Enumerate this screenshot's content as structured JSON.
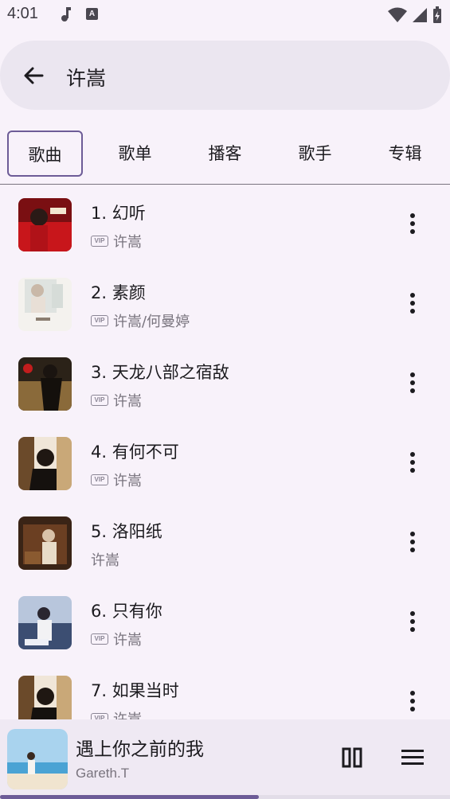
{
  "status": {
    "time": "4:01"
  },
  "search": {
    "query": "许嵩"
  },
  "tabs": [
    {
      "label": "歌曲",
      "active": true
    },
    {
      "label": "歌单",
      "active": false
    },
    {
      "label": "播客",
      "active": false
    },
    {
      "label": "歌手",
      "active": false
    },
    {
      "label": "专辑",
      "active": false
    }
  ],
  "songs": [
    {
      "title": "1. 幻听",
      "artist": "许嵩",
      "vip": true
    },
    {
      "title": "2. 素颜",
      "artist": "许嵩/何曼婷",
      "vip": true
    },
    {
      "title": "3. 天龙八部之宿敌",
      "artist": "许嵩",
      "vip": true
    },
    {
      "title": "4. 有何不可",
      "artist": "许嵩",
      "vip": true
    },
    {
      "title": "5. 洛阳纸",
      "artist": "许嵩",
      "vip": false
    },
    {
      "title": "6. 只有你",
      "artist": "许嵩",
      "vip": true
    },
    {
      "title": "7. 如果当时",
      "artist": "许嵩",
      "vip": true
    }
  ],
  "vip_label": "VIP",
  "player": {
    "title": "遇上你之前的我",
    "artist": "Gareth.T",
    "progress": 0.575
  },
  "colors": {
    "accent": "#6d5c97",
    "background": "#f8f2fa",
    "search_bg": "#ebe6f0"
  }
}
